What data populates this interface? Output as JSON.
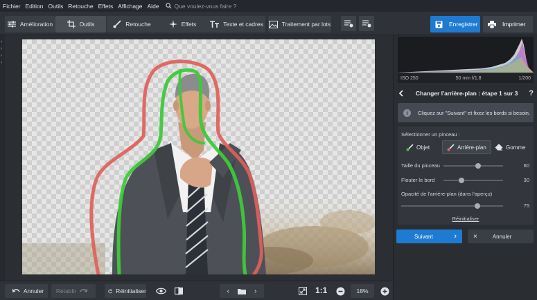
{
  "menu": {
    "items": [
      "Fichier",
      "Edition",
      "Outils",
      "Retouche",
      "Effets",
      "Affichage",
      "Aide"
    ],
    "search_placeholder": "Que voulez-vous faire ?"
  },
  "toolbar": {
    "tabs": [
      {
        "label": "Amélioration",
        "icon": "sliders-icon"
      },
      {
        "label": "Outils",
        "icon": "crop-icon"
      },
      {
        "label": "Retouche",
        "icon": "brush-icon"
      },
      {
        "label": "Effets",
        "icon": "sparkle-icon"
      },
      {
        "label": "Texte et cadres",
        "icon": "text-icon"
      },
      {
        "label": "Traitement par lots",
        "icon": "images-icon"
      }
    ],
    "active_tab": "Outils",
    "save_label": "Enregistrer",
    "print_label": "Imprimer",
    "accent": "#1f7ad1"
  },
  "exif": {
    "iso": "ISO 250",
    "lens": "50 mm f/1.8",
    "shutter": "1/200"
  },
  "panel": {
    "step_title": "Changer l'arrière-plan : étape 1 sur 3",
    "help": "?",
    "info_text": "Cliquez sur \"Suivant\" et fixez les bords si besoin.",
    "brush_label": "Sélectionner un pinceau :",
    "brushes": [
      "Objet",
      "Arrière-plan",
      "Gomme"
    ],
    "active_brush": "Arrière-plan",
    "sliders": [
      {
        "label": "Taille du pinceau",
        "value": 60,
        "fraction": 0.58
      },
      {
        "label": "Flouter le bord",
        "value": 30,
        "fraction": 0.3
      },
      {
        "label": "Opacité de l'arrière-plan (dans l'aperçu)",
        "value": 75,
        "fraction": 0.75
      }
    ],
    "reset_label": "Réinitialiser",
    "next_label": "Suivant",
    "cancel_label": "Annuler"
  },
  "bottom": {
    "undo_label": "Annuler",
    "redo_label": "Rétablir",
    "reset_label": "Réinitialiser",
    "ratio_label": "1:1",
    "zoom": "18%"
  },
  "colors": {
    "foreground_stroke": "#3ec93a",
    "background_stroke": "#e0605a"
  }
}
